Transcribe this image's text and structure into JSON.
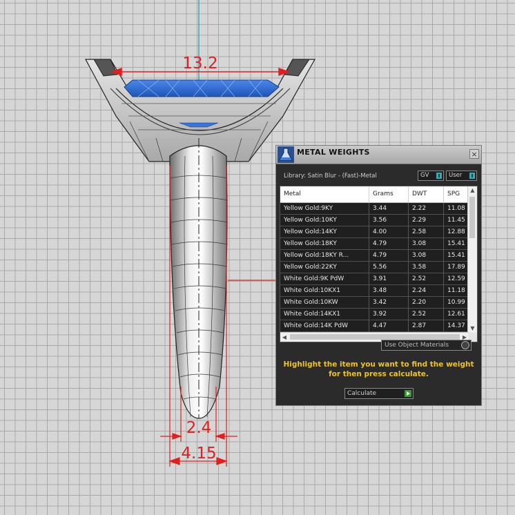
{
  "viewport": {
    "dimensions": {
      "top_width": "13.2",
      "inner_bottom_width": "2.4",
      "outer_bottom_width": "4.15"
    }
  },
  "panel": {
    "title": "METAL WEIGHTS",
    "close_label": "×",
    "library_label": "Library: Satin Blur - (Fast)-Metal",
    "gv_label": "GV",
    "user_label": "User",
    "columns": [
      "Metal",
      "Grams",
      "DWT",
      "SPG"
    ],
    "rows": [
      [
        "Yellow Gold:9KY",
        "3.44",
        "2.22",
        "11.08"
      ],
      [
        "Yellow Gold:10KY",
        "3.56",
        "2.29",
        "11.45"
      ],
      [
        "Yellow Gold:14KY",
        "4.00",
        "2.58",
        "12.88"
      ],
      [
        "Yellow Gold:18KY",
        "4.79",
        "3.08",
        "15.41"
      ],
      [
        "Yellow Gold:18KY R...",
        "4.79",
        "3.08",
        "15.41"
      ],
      [
        "Yellow Gold:22KY",
        "5.56",
        "3.58",
        "17.89"
      ],
      [
        "White Gold:9K PdW",
        "3.91",
        "2.52",
        "12.59"
      ],
      [
        "White Gold:10KX1",
        "3.48",
        "2.24",
        "11.18"
      ],
      [
        "White Gold:10KW",
        "3.42",
        "2.20",
        "10.99"
      ],
      [
        "White Gold:14KX1",
        "3.92",
        "2.52",
        "12.61"
      ],
      [
        "White Gold:14K PdW",
        "4.47",
        "2.87",
        "14.37"
      ]
    ],
    "materials_dropdown": "Use Object Materials",
    "hint_text": "Highlight the item you want to find the weight for then press calculate.",
    "calculate_label": "Calculate",
    "colors": {
      "hint": "#f0c419",
      "dimension": "#e02020",
      "gem": "#2f6fd8"
    }
  }
}
